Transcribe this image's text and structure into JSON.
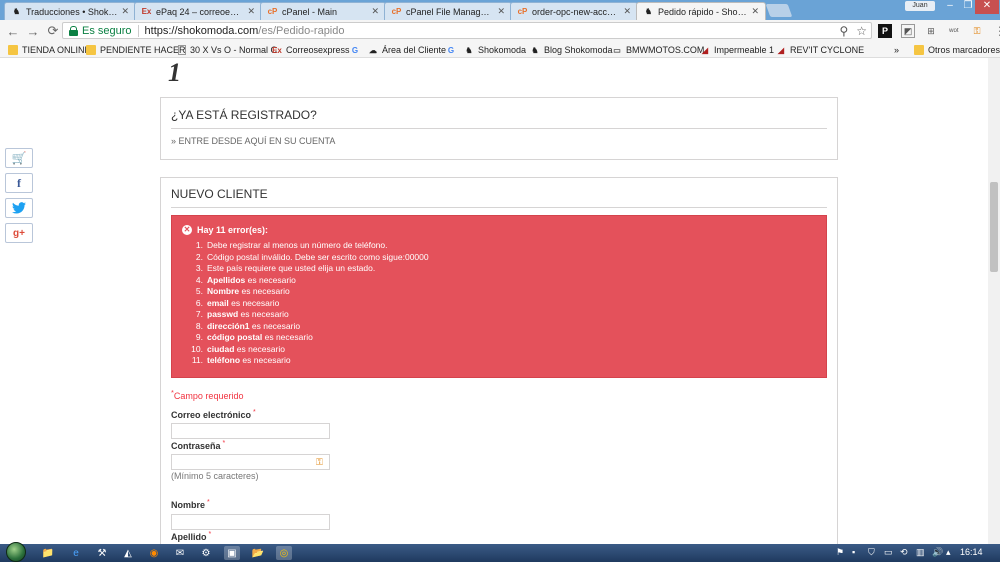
{
  "window": {
    "user": "Juan",
    "controls": [
      "–",
      "❐",
      "✕"
    ]
  },
  "tabs": [
    {
      "label": "Traducciones • Shokomoda",
      "icon": "shokomoda-icon"
    },
    {
      "label": "ePaq 24 – correoexpress",
      "icon": "correoexpress-icon"
    },
    {
      "label": "cPanel - Main",
      "icon": "cpanel-icon"
    },
    {
      "label": "cPanel File Manager v3",
      "icon": "cpanel-icon"
    },
    {
      "label": "order-opc-new-account",
      "icon": "cpanel-icon"
    },
    {
      "label": "Pedido rápido - Shokomoda",
      "icon": "shokomoda-icon"
    }
  ],
  "address_bar": {
    "secure_label": "Es seguro",
    "url_host": "https://shokomoda.com",
    "url_path": "/es/Pedido-rapido"
  },
  "bookmarks": [
    {
      "label": "TIENDA ONLINE",
      "icon": "folder-icon"
    },
    {
      "label": "PENDIENTE HACER",
      "icon": "folder-icon"
    },
    {
      "label": "30 X Vs O - Normal C",
      "icon": "page-icon"
    },
    {
      "label": "Correosexpress",
      "icon": "correoexpress-icon"
    },
    {
      "label": "",
      "icon": "google-icon"
    },
    {
      "label": "Área del Cliente",
      "icon": "cloud-icon"
    },
    {
      "label": "",
      "icon": "google-icon"
    },
    {
      "label": "Shokomoda",
      "icon": "shokomoda-icon"
    },
    {
      "label": "Blog Shokomoda",
      "icon": "shokomoda-icon"
    },
    {
      "label": "BMWMOTOS.COM",
      "icon": "bmw-icon"
    },
    {
      "label": "Impermeable 1",
      "icon": "rev-icon"
    },
    {
      "label": "REV'IT CYCLONE",
      "icon": "rev-icon"
    },
    {
      "label": "Otros marcadores",
      "icon": "folder-icon"
    }
  ],
  "bookmarks_overflow": "»",
  "page": {
    "step_number": "1",
    "registered": {
      "title": "¿YA ESTÁ REGISTRADO?",
      "link": "» ENTRE DESDE AQUÍ EN SU CUENTA"
    },
    "new_client": {
      "title": "NUEVO CLIENTE",
      "error_heading": "Hay 11 error(es):",
      "errors": [
        {
          "num": "1.",
          "bold": "",
          "text": "Debe registrar al menos un número de teléfono."
        },
        {
          "num": "2.",
          "bold": "",
          "text": "Código postal inválido. Debe ser escrito como sigue:00000"
        },
        {
          "num": "3.",
          "bold": "",
          "text": "Este país requiere que usted elija un estado."
        },
        {
          "num": "4.",
          "bold": "Apellidos",
          "text": " es necesario"
        },
        {
          "num": "5.",
          "bold": "Nombre",
          "text": " es necesario"
        },
        {
          "num": "6.",
          "bold": "email",
          "text": " es necesario"
        },
        {
          "num": "7.",
          "bold": "passwd",
          "text": " es necesario"
        },
        {
          "num": "8.",
          "bold": "dirección1",
          "text": " es necesario"
        },
        {
          "num": "9.",
          "bold": "código postal",
          "text": " es necesario"
        },
        {
          "num": "10.",
          "bold": "ciudad",
          "text": " es necesario"
        },
        {
          "num": "11.",
          "bold": "teléfono",
          "text": " es necesario"
        }
      ],
      "required_note": "Campo requerido",
      "required_mark": "*",
      "fields": {
        "email_label": "Correo electrónico",
        "email_value": "",
        "password_label": "Contraseña",
        "password_value": "",
        "password_hint": "(Mínimo 5 caracteres)",
        "firstname_label": "Nombre",
        "firstname_value": "",
        "lastname_label": "Apellido"
      }
    }
  },
  "social_buttons": [
    {
      "name": "cart-icon",
      "glyph": "🛒"
    },
    {
      "name": "facebook-icon",
      "glyph": "f"
    },
    {
      "name": "twitter-icon",
      "glyph": "🐦"
    },
    {
      "name": "google-plus-icon",
      "glyph": "g+"
    }
  ],
  "taskbar": {
    "clock": "16:14"
  },
  "colors": {
    "alert_bg": "#e4515b",
    "secure_green": "#0b8043",
    "required_red": "#f13340"
  }
}
